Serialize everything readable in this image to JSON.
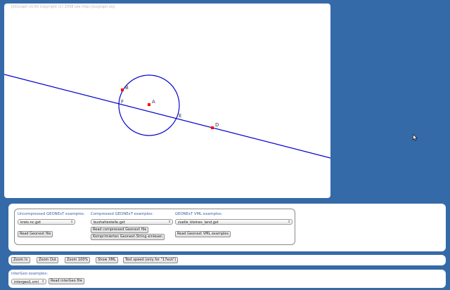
{
  "board": {
    "copyright": "JSXGraph v0.60 Copyright (C) 2008 see http://jsxgraph.org",
    "points": [
      {
        "name": "A",
        "label": "A"
      },
      {
        "name": "B",
        "label": "B"
      },
      {
        "name": "D",
        "label": "D"
      },
      {
        "name": "E",
        "label": "E"
      },
      {
        "name": "F",
        "label": "F"
      }
    ]
  },
  "examples": {
    "uncompressed_label": "Uncompressed GEONExT examples:",
    "uncompressed_select": "kreis.nc.gxt",
    "uncompressed_button": "Read Geonext file",
    "compressed_label": "Compressed GEONExT examples:",
    "compressed_select": "bushaltestelle.gxt",
    "compressed_button": "Read compressed Geonext file",
    "compressed_string_button": "Komprimierten Geonext-String einlesen",
    "vml_label": "GEONExT VML examples:",
    "vml_select": "zuelle_kleines_land.gxt",
    "vml_button": "Read Geonext VML examples"
  },
  "toolbar": {
    "zoom_in": "Zoom In",
    "zoom_out": "Zoom Out",
    "zoom_100": "Zoom 100%",
    "show_xml": "Show XML",
    "test_speed": "Test speed (only for \"17eck\")"
  },
  "intergeo": {
    "label": "interGeo examples:",
    "select": "intergeo1.xml",
    "button": "Read interGeo file"
  },
  "colors": {
    "background": "#356aa8",
    "accent": "#0000cc",
    "point": "#ff0000"
  },
  "icons": {
    "dropdown": "chevron-updown-icon",
    "cursor": "mouse-pointer-icon"
  }
}
